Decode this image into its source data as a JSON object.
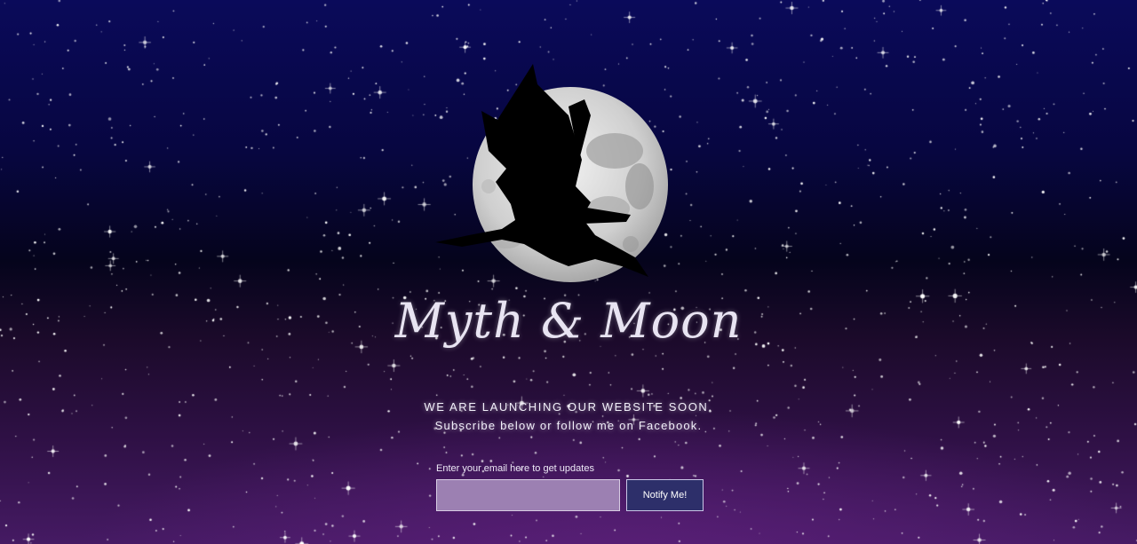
{
  "brand": {
    "name": "Myth & Moon"
  },
  "hero": {
    "announcement": "WE ARE LAUNCHING OUR WEBSITE SOON.",
    "subtext": "Subscribe below or follow me on Facebook."
  },
  "signup": {
    "label": "Enter your email here to get updates",
    "email_value": "",
    "placeholder": "",
    "button_label": "Notify Me!"
  },
  "colors": {
    "sky_top": "#0a0a5a",
    "sky_bottom": "#451a63",
    "moon": "#d9d9d9",
    "input_fill": "#9c80b2",
    "button_fill": "#2d2f6a"
  },
  "icons": {
    "hero_art": "dragon-moon-icon",
    "background": "starfield"
  }
}
